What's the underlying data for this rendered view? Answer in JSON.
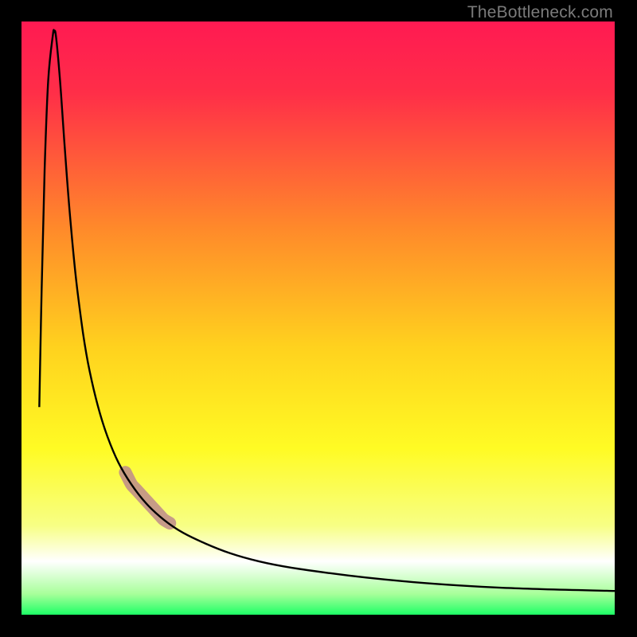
{
  "attribution": "TheBottleneck.com",
  "chart_data": {
    "type": "line",
    "title": "",
    "xlabel": "",
    "ylabel": "",
    "xlim": [
      0,
      100
    ],
    "ylim": [
      0,
      100
    ],
    "gradient_stops": [
      {
        "pos": 0.0,
        "color": "#ff1a52"
      },
      {
        "pos": 0.12,
        "color": "#ff2e48"
      },
      {
        "pos": 0.35,
        "color": "#ff8a2a"
      },
      {
        "pos": 0.55,
        "color": "#ffd21e"
      },
      {
        "pos": 0.72,
        "color": "#fffb24"
      },
      {
        "pos": 0.85,
        "color": "#f7ff85"
      },
      {
        "pos": 0.91,
        "color": "#ffffff"
      },
      {
        "pos": 0.965,
        "color": "#a8ff9a"
      },
      {
        "pos": 1.0,
        "color": "#1eff66"
      }
    ],
    "series": [
      {
        "name": "bottleneck-curve",
        "points": [
          {
            "x": 3.0,
            "y": 35.0
          },
          {
            "x": 3.4,
            "y": 55.0
          },
          {
            "x": 3.9,
            "y": 75.0
          },
          {
            "x": 4.5,
            "y": 90.0
          },
          {
            "x": 5.3,
            "y": 97.8
          },
          {
            "x": 5.5,
            "y": 98.2
          },
          {
            "x": 5.8,
            "y": 97.6
          },
          {
            "x": 6.5,
            "y": 90.0
          },
          {
            "x": 7.2,
            "y": 80.0
          },
          {
            "x": 8.2,
            "y": 67.0
          },
          {
            "x": 9.5,
            "y": 54.0
          },
          {
            "x": 11.5,
            "y": 41.0
          },
          {
            "x": 14.5,
            "y": 30.0
          },
          {
            "x": 18.5,
            "y": 22.0
          },
          {
            "x": 24.0,
            "y": 16.0
          },
          {
            "x": 31.0,
            "y": 12.0
          },
          {
            "x": 40.0,
            "y": 9.0
          },
          {
            "x": 52.0,
            "y": 7.0
          },
          {
            "x": 66.0,
            "y": 5.5
          },
          {
            "x": 82.0,
            "y": 4.5
          },
          {
            "x": 100.0,
            "y": 4.0
          }
        ]
      }
    ],
    "highlight": {
      "x_start": 17.5,
      "x_end": 25.0
    }
  }
}
